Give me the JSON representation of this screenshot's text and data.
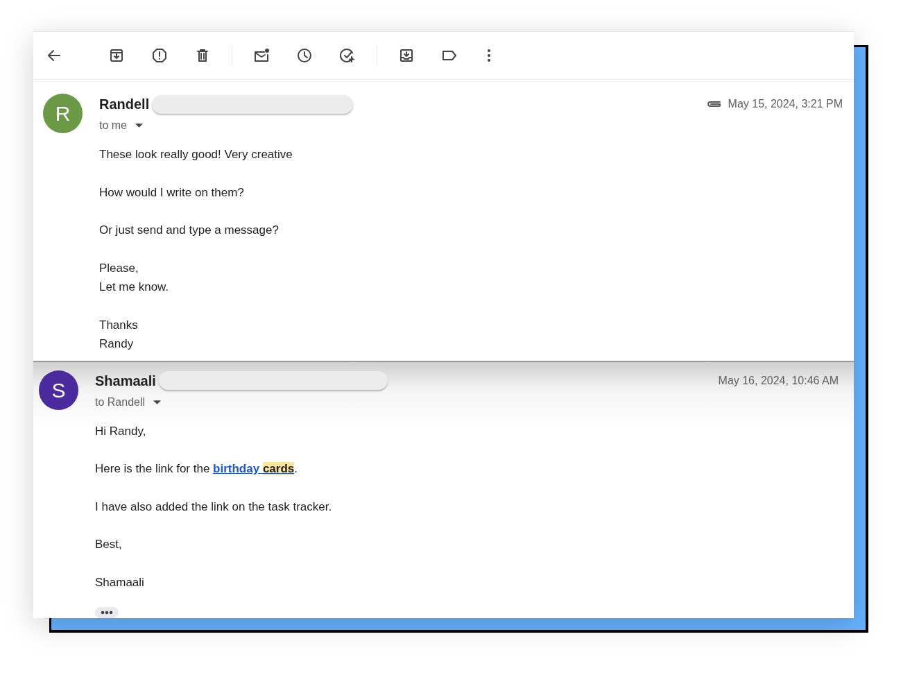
{
  "messages": [
    {
      "initial": "R",
      "color": "#6a9a45",
      "sender": "Randell",
      "recipient": "to me",
      "attachment": true,
      "date": "May 15, 2024, 3:21 PM",
      "shaded": false,
      "paragraphs": [
        [
          [
            {
              "kind": "text",
              "text": "These look really good! Very creative"
            }
          ]
        ],
        [
          [
            {
              "kind": "text",
              "text": "How would I write on them?"
            }
          ]
        ],
        [
          [
            {
              "kind": "text",
              "text": "Or just send and type a message?"
            }
          ]
        ],
        [
          [
            {
              "kind": "text",
              "text": "Please,"
            }
          ],
          [
            {
              "kind": "text",
              "text": "Let me know."
            }
          ]
        ],
        [
          [
            {
              "kind": "text",
              "text": "Thanks"
            }
          ],
          [
            {
              "kind": "text",
              "text": "Randy"
            }
          ]
        ]
      ],
      "show_trimmed": false
    },
    {
      "initial": "S",
      "color": "#4a2a9c",
      "sender": "Shamaali",
      "recipient": "to Randell",
      "attachment": false,
      "date": "May 16, 2024, 10:46 AM",
      "shaded": true,
      "paragraphs": [
        [
          [
            {
              "kind": "text",
              "text": "Hi Randy,"
            }
          ]
        ],
        [
          [
            {
              "kind": "text",
              "text": "Here is the link for the "
            },
            {
              "kind": "link",
              "text": "birthday ",
              "highlight": "cards"
            },
            {
              "kind": "text",
              "text": "."
            }
          ]
        ],
        [
          [
            {
              "kind": "text",
              "text": "I have also added the link on the task tracker."
            }
          ]
        ],
        [
          [
            {
              "kind": "text",
              "text": "Best,"
            }
          ]
        ],
        [
          [
            {
              "kind": "text",
              "text": "Shamaali"
            }
          ]
        ]
      ],
      "show_trimmed": true
    }
  ]
}
